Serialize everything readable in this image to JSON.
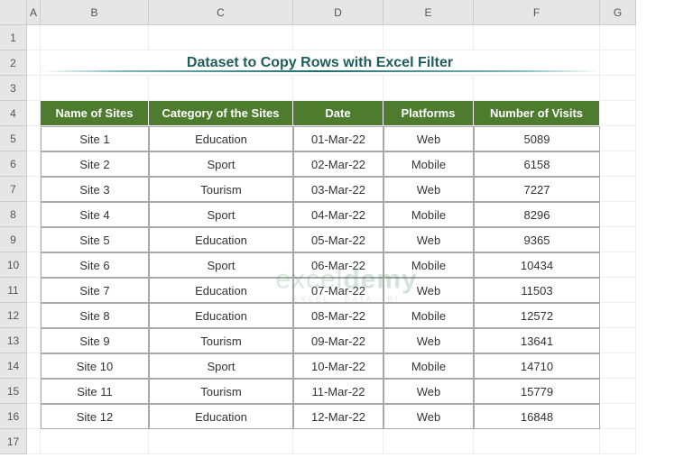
{
  "columns": [
    "A",
    "B",
    "C",
    "D",
    "E",
    "F",
    "G"
  ],
  "row_numbers": [
    1,
    2,
    3,
    4,
    5,
    6,
    7,
    8,
    9,
    10,
    11,
    12,
    13,
    14,
    15,
    16,
    17
  ],
  "title": "Dataset to Copy Rows with Excel Filter",
  "headers": {
    "name": "Name of Sites",
    "category": "Category of the Sites",
    "date": "Date",
    "platforms": "Platforms",
    "visits": "Number of Visits"
  },
  "rows": [
    {
      "name": "Site 1",
      "category": "Education",
      "date": "01-Mar-22",
      "platforms": "Web",
      "visits": "5089"
    },
    {
      "name": "Site 2",
      "category": "Sport",
      "date": "02-Mar-22",
      "platforms": "Mobile",
      "visits": "6158"
    },
    {
      "name": "Site 3",
      "category": "Tourism",
      "date": "03-Mar-22",
      "platforms": "Web",
      "visits": "7227"
    },
    {
      "name": "Site 4",
      "category": "Sport",
      "date": "04-Mar-22",
      "platforms": "Mobile",
      "visits": "8296"
    },
    {
      "name": "Site 5",
      "category": "Education",
      "date": "05-Mar-22",
      "platforms": "Web",
      "visits": "9365"
    },
    {
      "name": "Site 6",
      "category": "Sport",
      "date": "06-Mar-22",
      "platforms": "Mobile",
      "visits": "10434"
    },
    {
      "name": "Site 7",
      "category": "Education",
      "date": "07-Mar-22",
      "platforms": "Web",
      "visits": "11503"
    },
    {
      "name": "Site 8",
      "category": "Education",
      "date": "08-Mar-22",
      "platforms": "Mobile",
      "visits": "12572"
    },
    {
      "name": "Site 9",
      "category": "Tourism",
      "date": "09-Mar-22",
      "platforms": "Web",
      "visits": "13641"
    },
    {
      "name": "Site 10",
      "category": "Sport",
      "date": "10-Mar-22",
      "platforms": "Mobile",
      "visits": "14710"
    },
    {
      "name": "Site 11",
      "category": "Tourism",
      "date": "11-Mar-22",
      "platforms": "Web",
      "visits": "15779"
    },
    {
      "name": "Site 12",
      "category": "Education",
      "date": "12-Mar-22",
      "platforms": "Web",
      "visits": "16848"
    }
  ],
  "watermark": {
    "brand_left": "excel",
    "brand_right": "demy",
    "tagline": "EXCEL · DATA · BI"
  }
}
